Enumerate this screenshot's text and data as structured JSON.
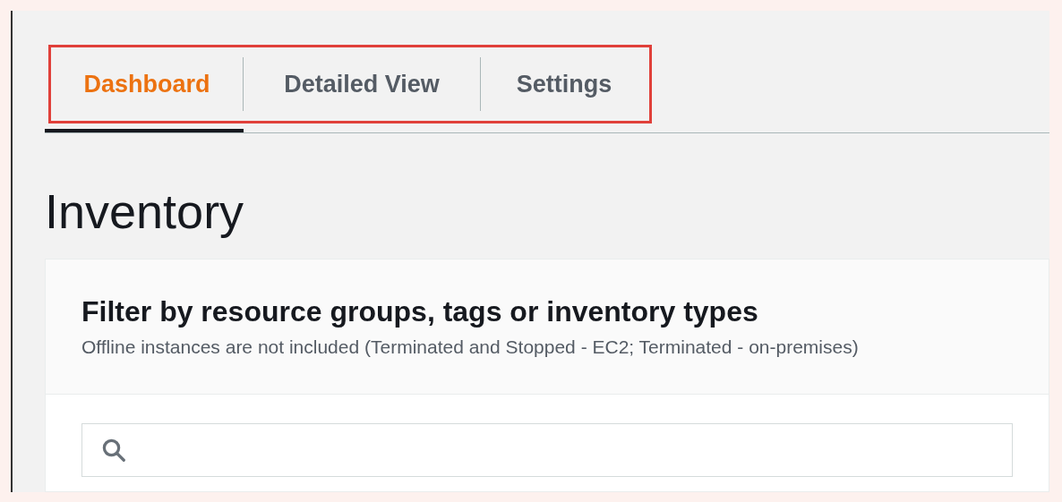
{
  "tabs": [
    {
      "label": "Dashboard",
      "selected": true
    },
    {
      "label": "Detailed View",
      "selected": false
    },
    {
      "label": "Settings",
      "selected": false
    }
  ],
  "title": "Inventory",
  "filter_panel": {
    "heading": "Filter by resource groups, tags or inventory types",
    "description": "Offline instances are not included (Terminated and Stopped - EC2; Terminated - on-premises)"
  }
}
